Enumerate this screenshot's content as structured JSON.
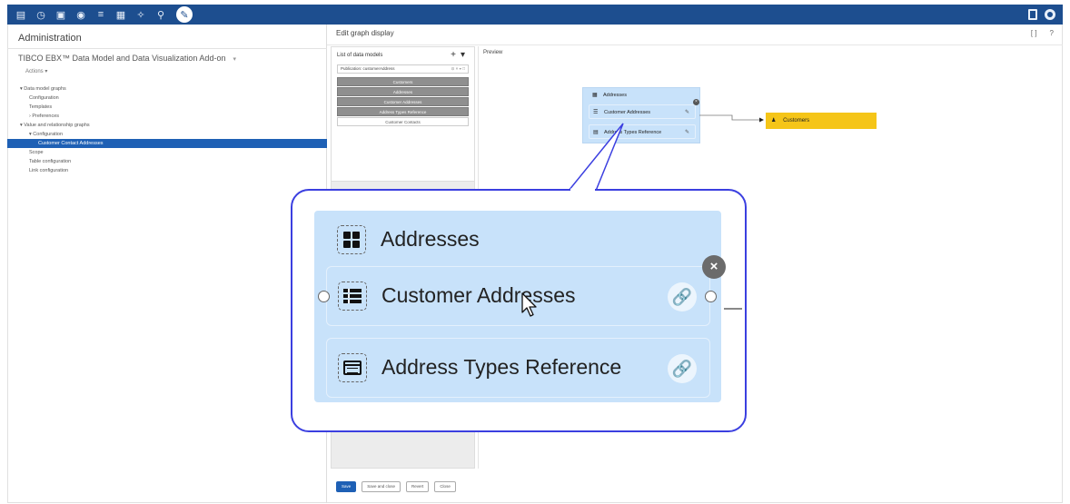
{
  "toolbar": {
    "icons": [
      "database-icon",
      "history-icon",
      "data-space-icon",
      "data-workflow-icon",
      "data-model-icon",
      "publication-icon",
      "admin-tool-icon",
      "search-icon",
      "edit-pencil-icon"
    ],
    "glyphs": [
      "▤",
      "◷",
      "▣",
      "◉",
      "≡",
      "▦",
      "✧",
      "⚲",
      "✎"
    ],
    "right_icons": [
      "sidebar-icon",
      "user-avatar-icon"
    ]
  },
  "left": {
    "admin_title": "Administration",
    "app_title": "TIBCO EBX™ Data Model and Data Visualization Add-on",
    "actions": "Actions ▾",
    "tree": [
      {
        "label": "▾ Data model graphs",
        "indent": 0
      },
      {
        "label": "Configuration",
        "indent": 1
      },
      {
        "label": "Templates",
        "indent": 1
      },
      {
        "label": "› Preferences",
        "indent": 1
      },
      {
        "label": "▾ Value and relationship graphs",
        "indent": 0
      },
      {
        "label": "▾ Configuration",
        "indent": 1
      },
      {
        "label": "Customer Contact Addresses",
        "indent": 2,
        "selected": true
      },
      {
        "label": "Scope",
        "indent": 1
      },
      {
        "label": "Table configuration",
        "indent": 1
      },
      {
        "label": "Link configuration",
        "indent": 1
      }
    ]
  },
  "right": {
    "edit_title": "Edit graph display",
    "header_icons": [
      "[ ]",
      "?"
    ]
  },
  "list": {
    "title": "List of data models",
    "plus": "+",
    "dropdown": "▾",
    "publication": "Publication: customerAddress",
    "publication_icons": "⊙ × ⫧ □",
    "items": [
      {
        "label": "Customers",
        "style": "gray"
      },
      {
        "label": "Addresses",
        "style": "gray"
      },
      {
        "label": "Customer Addresses",
        "style": "gray"
      },
      {
        "label": "Address Types Reference",
        "style": "gray"
      },
      {
        "label": "Customer Contacts",
        "style": "white"
      }
    ]
  },
  "preview": {
    "label": "Preview",
    "mini": {
      "group_title": "Addresses",
      "rows": [
        "Customer Addresses",
        "Address Types Reference"
      ],
      "target": "Customers"
    }
  },
  "zoom": {
    "group_title": "Addresses",
    "rows": [
      {
        "label": "Customer Addresses",
        "icon": "table-list-icon"
      },
      {
        "label": "Address Types Reference",
        "icon": "reference-table-icon"
      }
    ],
    "close": "×"
  },
  "buttons": {
    "save": "Save",
    "save_close": "Save and close",
    "revert": "Revert",
    "close": "Close"
  },
  "colors": {
    "topbar": "#1d4e8f",
    "selected": "#1e60b5",
    "group_bg": "#c8e2fa",
    "customers_node": "#f5c518",
    "callout_border": "#3b3fe0"
  }
}
